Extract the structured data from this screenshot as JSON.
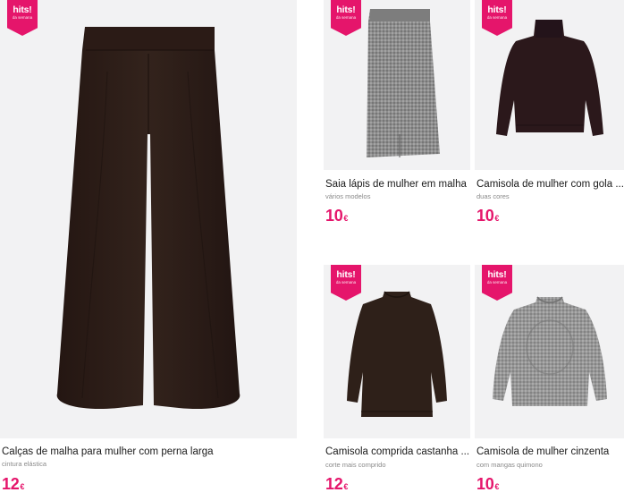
{
  "products": [
    {
      "name": "Calças de malha para mulher com perna larga",
      "subtitle": "cintura elástica",
      "price": "12",
      "currency": "€",
      "badge_main": "hits!",
      "badge_sub": "da semana",
      "image_icon": "wide-leg-pants-image",
      "image_color": "#2c1d17"
    },
    {
      "name": "Saia lápis de mulher em malha",
      "subtitle": "vários modelos",
      "price": "10",
      "currency": "€",
      "badge_main": "hits!",
      "badge_sub": "da semana",
      "image_icon": "pencil-skirt-image",
      "image_color": "#8e8e8e"
    },
    {
      "name": "Camisola de mulher com gola ...",
      "subtitle": "duas cores",
      "price": "10",
      "currency": "€",
      "badge_main": "hits!",
      "badge_sub": "da semana",
      "image_icon": "turtleneck-sweater-image",
      "image_color": "#2a181b"
    },
    {
      "name": "Camisola comprida castanha ...",
      "subtitle": "corte mais comprido",
      "price": "12",
      "currency": "€",
      "badge_main": "hits!",
      "badge_sub": "da semana",
      "image_icon": "long-brown-sweater-image",
      "image_color": "#2e2119"
    },
    {
      "name": "Camisola de mulher cinzenta",
      "subtitle": "com mangas quimono",
      "price": "10",
      "currency": "€",
      "badge_main": "hits!",
      "badge_sub": "da semana",
      "image_icon": "grey-sweater-image",
      "image_color": "#9a9a9a"
    }
  ],
  "colors": {
    "accent": "#e5156b",
    "tile_bg": "#f2f2f3",
    "subtitle": "#8a8a8a"
  }
}
